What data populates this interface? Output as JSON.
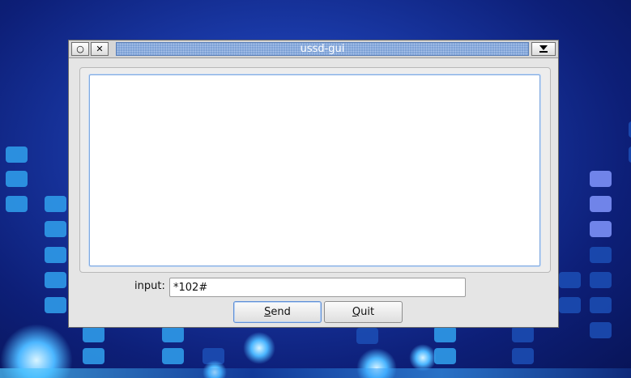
{
  "window": {
    "title": "ussd-gui",
    "controls": {
      "minimize_icon": "circle-icon",
      "close_icon": "close-icon",
      "menu_icon": "dropdown-arrow-icon"
    }
  },
  "output": {
    "content": ""
  },
  "input": {
    "label": "input:",
    "value": "*102#"
  },
  "buttons": {
    "send": {
      "mnemonic": "S",
      "rest": "end"
    },
    "quit": {
      "mnemonic": "Q",
      "rest": "uit"
    }
  },
  "colors": {
    "title_accent": "#7ea2d6",
    "focus_border": "#5f8fd6"
  }
}
